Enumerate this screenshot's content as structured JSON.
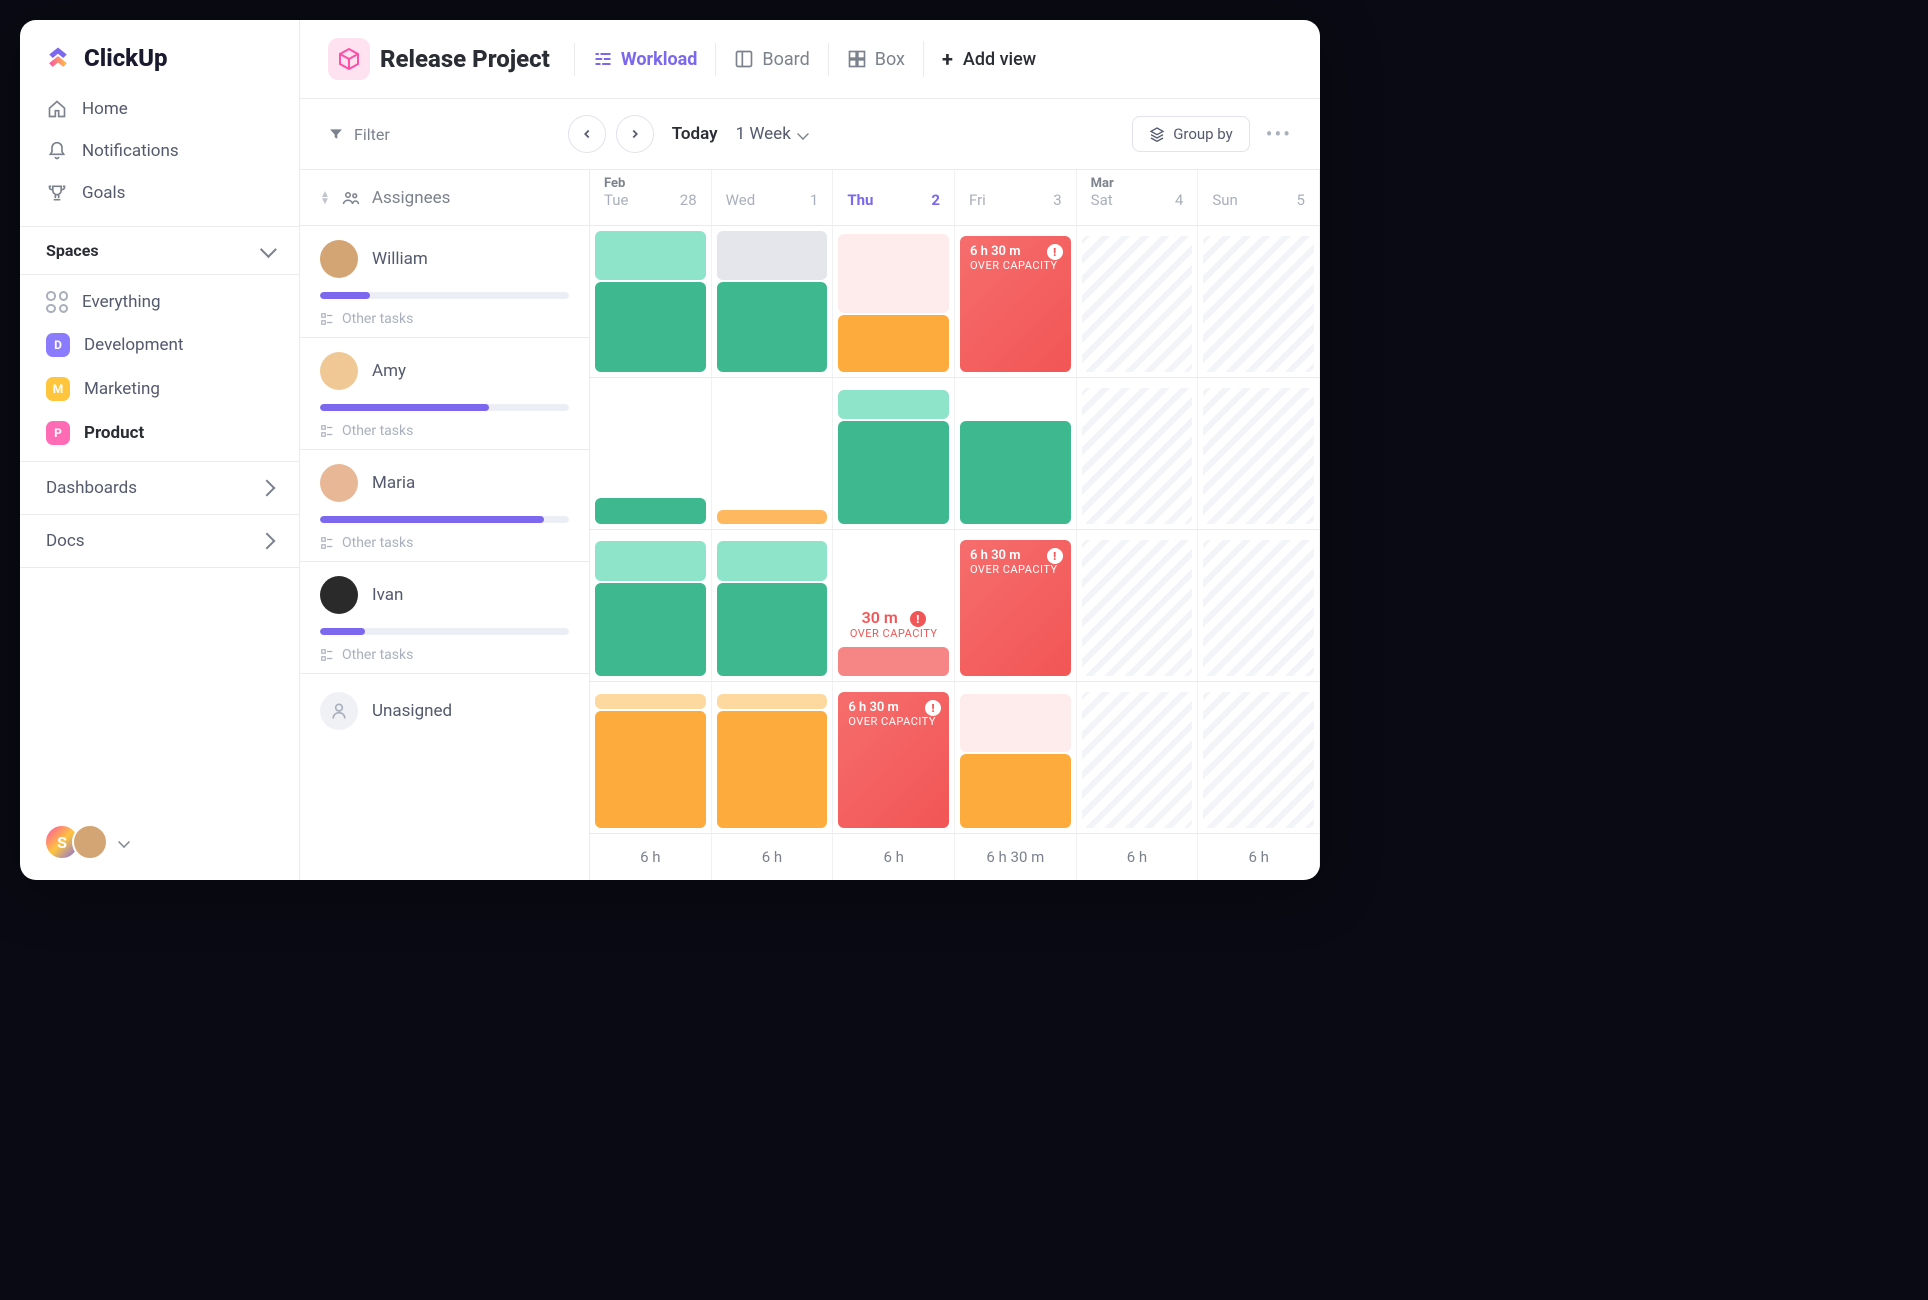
{
  "app_name": "ClickUp",
  "nav": {
    "home": "Home",
    "notifications": "Notifications",
    "goals": "Goals"
  },
  "spaces": {
    "title": "Spaces",
    "everything": "Everything",
    "items": [
      {
        "letter": "D",
        "label": "Development",
        "color": "#8b7bff"
      },
      {
        "letter": "M",
        "label": "Marketing",
        "color": "#ffc53d"
      },
      {
        "letter": "P",
        "label": "Product",
        "color": "#ff6bb5",
        "active": true
      }
    ]
  },
  "sections": {
    "dashboards": "Dashboards",
    "docs": "Docs"
  },
  "header": {
    "project_title": "Release Project",
    "views": [
      {
        "label": "Workload",
        "active": true
      },
      {
        "label": "Board"
      },
      {
        "label": "Box"
      }
    ],
    "add_view": "Add view"
  },
  "toolbar": {
    "filter": "Filter",
    "today": "Today",
    "range": "1 Week",
    "group_by": "Group by"
  },
  "assignees": {
    "header": "Assignees",
    "other_tasks": "Other tasks",
    "unassigned": "Unasigned",
    "rows": [
      {
        "name": "William",
        "progress": 20
      },
      {
        "name": "Amy",
        "progress": 68
      },
      {
        "name": "Maria",
        "progress": 90
      },
      {
        "name": "Ivan",
        "progress": 18
      }
    ]
  },
  "calendar": {
    "columns": [
      {
        "month": "Feb",
        "day": "Tue",
        "num": "28"
      },
      {
        "month": "",
        "day": "Wed",
        "num": "1"
      },
      {
        "month": "",
        "day": "Thu",
        "num": "2",
        "today": true
      },
      {
        "month": "",
        "day": "Fri",
        "num": "3"
      },
      {
        "month": "Mar",
        "day": "Sat",
        "num": "4",
        "weekend": true
      },
      {
        "month": "",
        "day": "Sun",
        "num": "5",
        "weekend": true
      }
    ],
    "over_capacity_label": "OVER CAPACITY",
    "over_time_1": "6 h 30 m",
    "over_time_2": "30 m",
    "footer": [
      "6 h",
      "6 h",
      "6 h",
      "6 h 30 m",
      "6 h",
      "6 h"
    ]
  },
  "user_badge": {
    "letter": "S"
  }
}
